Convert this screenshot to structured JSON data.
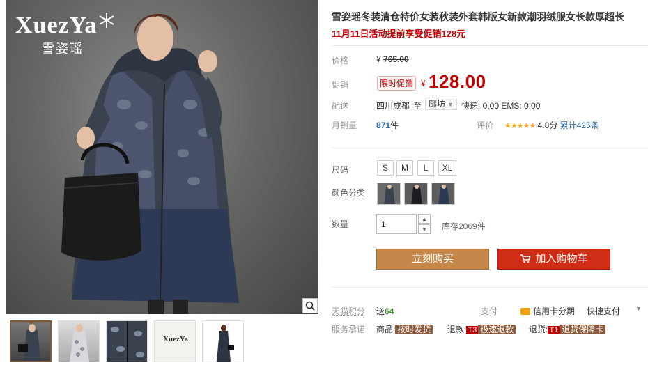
{
  "brand": {
    "logo_text": "XuezYa",
    "logo_cn": "雪姿瑶"
  },
  "product": {
    "title": "雪姿瑶冬装清仓特价女装秋装外套韩版女新款潮羽绒服女长款厚超长",
    "promo": "11月11日活动提前享受促销128元"
  },
  "price": {
    "label": "价格",
    "currency": "¥",
    "original": "765.00",
    "promo_label": "促销",
    "badge": "限时促销",
    "current": "128.00"
  },
  "shipping": {
    "label": "配送",
    "from": "四川成都",
    "to_word": "至",
    "to_city": "廊坊",
    "fees": "快递: 0.00 EMS: 0.00"
  },
  "sales": {
    "label": "月销量",
    "count": "871",
    "unit": "件",
    "rating_label": "评价",
    "stars": "★★★★★",
    "score": "4.8分",
    "reviews": "累计425条"
  },
  "size": {
    "label": "尺码",
    "options": [
      "S",
      "M",
      "L",
      "XL"
    ]
  },
  "color": {
    "label": "颜色分类"
  },
  "quantity": {
    "label": "数量",
    "value": "1",
    "stock": "库存2069件"
  },
  "buttons": {
    "buy_now": "立刻购买",
    "add_cart": "加入购物车"
  },
  "points": {
    "label": "天猫积分",
    "value_prefix": "送",
    "value": "64"
  },
  "payment": {
    "label": "支付",
    "credit": "信用卡分期",
    "quick": "快捷支付"
  },
  "service": {
    "label": "服务承诺",
    "goods_prefix": "商品:",
    "goods_tag": "按时发货",
    "refund_prefix": "退款:",
    "refund_code": "T3",
    "refund_tag": "极速退款",
    "return_prefix": "退货:",
    "return_code": "T1",
    "return_tag": "退货保障卡"
  },
  "thumbnails": {
    "logo_text": "XuezYa"
  },
  "colors": {
    "accent_red": "#c40000",
    "buy_button": "#c4884b",
    "cart_button": "#cf2d16",
    "link_blue": "#2464a4"
  },
  "icons": [
    "zoom-icon",
    "cart-icon",
    "chevron-down-icon",
    "snowflake-icon",
    "card-icon"
  ]
}
